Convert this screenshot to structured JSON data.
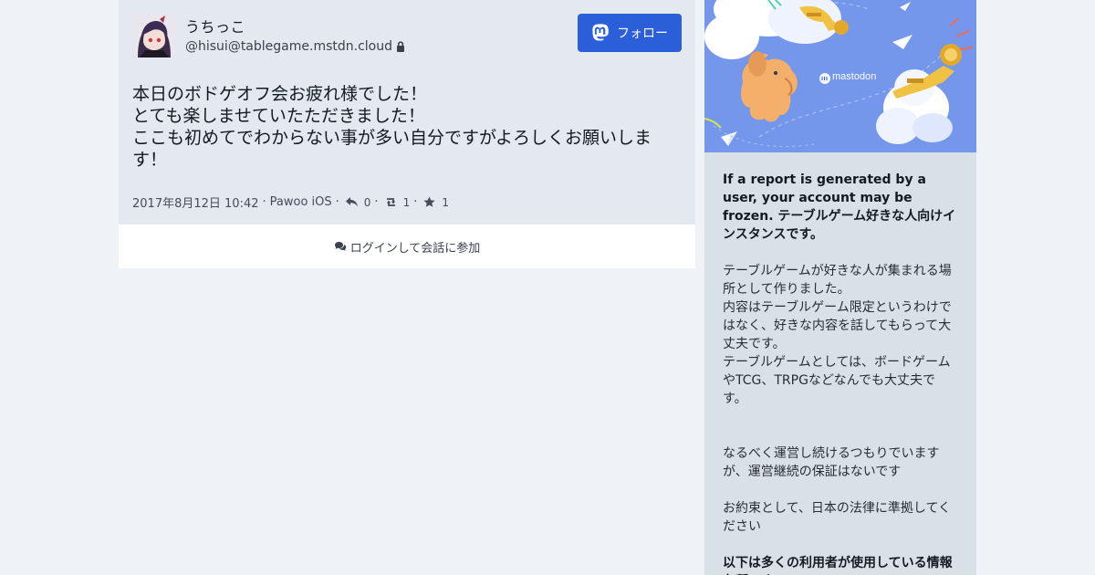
{
  "account": {
    "display_name": "うちっこ",
    "handle": "@hisui@tablegame.mstdn.cloud",
    "locked_icon": "lock-icon"
  },
  "follow_button": {
    "label": "フォロー",
    "icon": "mastodon-icon"
  },
  "status": {
    "lines": [
      "本日のボドゲオフ会お疲れ様でした！",
      "とても楽しませていたただきました！",
      "ここも初めてでわからない事が多い自分ですがよろしくお願いしま",
      "す！"
    ],
    "timestamp": "2017年8月12日 10:42",
    "application": "Pawoo iOS",
    "replies": "0",
    "boosts": "1",
    "favourites": "1"
  },
  "login_bar": {
    "label": "ログインして会話に参加",
    "icon": "comments-icon"
  },
  "sidebar": {
    "hero_logo_text": "mastodon",
    "headline": "If a report is generated by a user, your account may be frozen. テーブルゲーム好きな人向けインスタンスです。",
    "description_lines": [
      "テーブルゲームが好きな人が集まれる場所として作りました。",
      "内容はテーブルゲーム限定というわけではなく、好きな内容を話してもらって大丈夫です。",
      "テーブルゲームとしては、ボードゲームやTCG、TRPGなどなんでも大丈夫です。"
    ],
    "operation_note": "なるべく運営し続けるつもりでいますが、運営継続の保証はないです",
    "law_note": "お約束として、日本の法律に準拠してください",
    "info_heading": "以下は多くの利用者が使用している情報各種です。"
  },
  "colors": {
    "accent": "#2b5fd9",
    "page_bg": "#eff3f8",
    "card_bg": "#e4e8ef",
    "sidebar_bg": "#d9e1e8",
    "hero_bg": "#6f8fe6"
  }
}
